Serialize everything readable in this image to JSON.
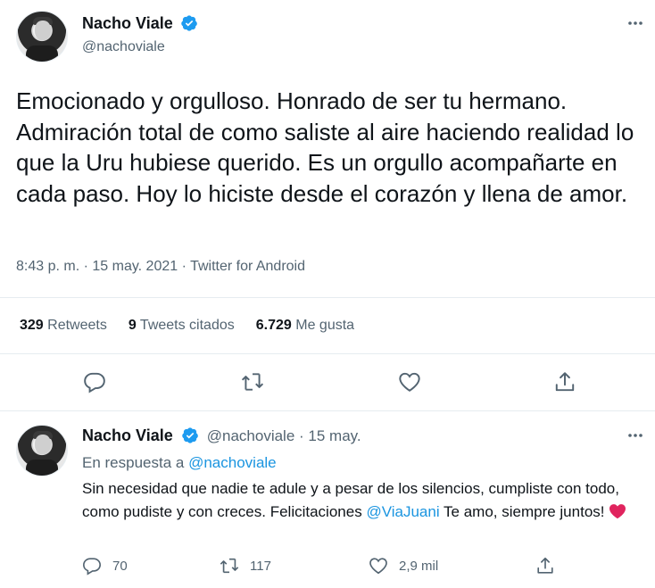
{
  "main_tweet": {
    "author_name": "Nacho Viale",
    "author_handle": "@nachoviale",
    "text": "Emocionado y orgulloso. Honrado de ser tu hermano. Admiración total de como saliste al aire haciendo realidad lo que la Uru hubiese querido. Es un orgullo acompañarte en cada paso. Hoy lo hiciste desde el corazón y llena de amor.",
    "meta": "8:43 p. m. · 15 may. 2021 · Twitter for Android",
    "stats": {
      "retweets_count": "329",
      "retweets_label": "Retweets",
      "quotes_count": "9",
      "quotes_label": "Tweets citados",
      "likes_count": "6.729",
      "likes_label": "Me gusta"
    },
    "icons": [
      "reply-icon",
      "retweet-icon",
      "like-icon",
      "share-icon"
    ]
  },
  "reply_tweet": {
    "author_name": "Nacho Viale",
    "author_handle_date": "@nachoviale · 15 may.",
    "in_reply_prefix": "En respuesta a",
    "in_reply_handle": "@nachoviale",
    "text_before_mention": "Sin necesidad que nadie te adule y a pesar de los silencios, cumpliste con todo, como pudiste y con creces. Felicitaciones",
    "mention": "@ViaJuani",
    "text_after_mention": " Te amo, siempre juntos!",
    "actions": {
      "replies": "70",
      "retweets": "117",
      "likes": "2,9 mil"
    }
  },
  "colors": {
    "verified": "#1d9bf0",
    "link": "#1b95e0",
    "heart": "#e0245e",
    "icon_gray": "#536471"
  }
}
